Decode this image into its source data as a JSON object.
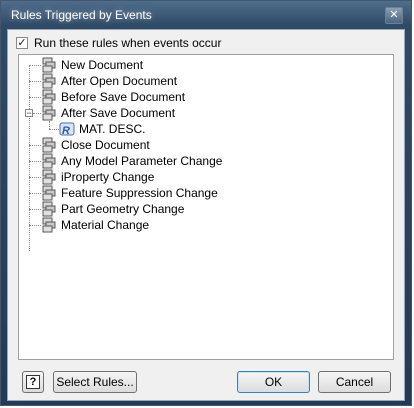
{
  "window": {
    "title": "Rules Triggered by Events",
    "close_glyph": "✕"
  },
  "option": {
    "label": "Run these rules when events occur",
    "checked": true,
    "check_glyph": "✓"
  },
  "tree": {
    "items": [
      {
        "label": "New Document",
        "icon": "event-rules-icon"
      },
      {
        "label": "After Open Document",
        "icon": "event-rules-icon"
      },
      {
        "label": "Before Save Document",
        "icon": "event-rules-icon"
      },
      {
        "label": "After Save Document",
        "icon": "event-rules-icon",
        "expanded": true,
        "children": [
          {
            "label": "MAT. DESC.",
            "icon": "ilogic-rule-icon"
          }
        ]
      },
      {
        "label": "Close Document",
        "icon": "event-rules-icon"
      },
      {
        "label": "Any Model Parameter Change",
        "icon": "event-rules-icon"
      },
      {
        "label": "iProperty Change",
        "icon": "event-rules-icon"
      },
      {
        "label": "Feature Suppression Change",
        "icon": "event-rules-icon"
      },
      {
        "label": "Part Geometry Change",
        "icon": "event-rules-icon"
      },
      {
        "label": "Material Change",
        "icon": "event-rules-icon"
      }
    ],
    "expander_glyph": "−"
  },
  "buttons": {
    "help": "?",
    "select_rules": "Select Rules...",
    "ok": "OK",
    "cancel": "Cancel"
  },
  "colors": {
    "accent": "#3c7fb1",
    "title_bar": "#2f4a66"
  }
}
